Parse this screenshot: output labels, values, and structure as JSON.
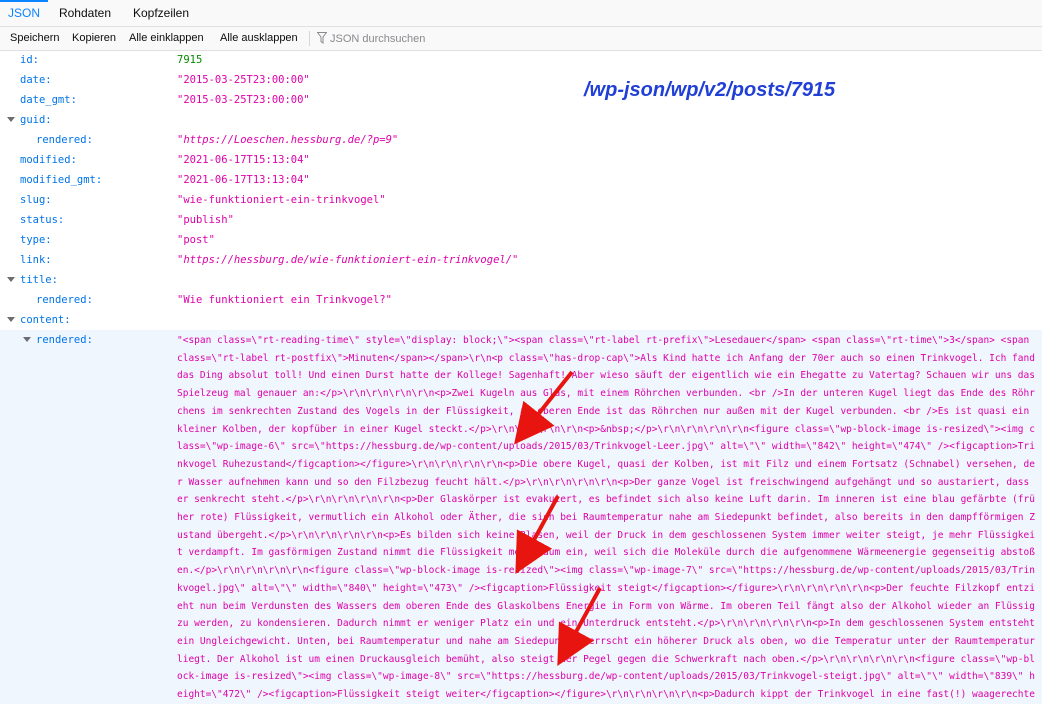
{
  "tabs": [
    {
      "label": "JSON",
      "active": true
    },
    {
      "label": "Rohdaten",
      "active": false
    },
    {
      "label": "Kopfzeilen",
      "active": false
    }
  ],
  "toolbar": {
    "save_label": "Speichern",
    "copy_label": "Kopieren",
    "collapse_all_label": "Alle einklappen",
    "expand_all_label": "Alle ausklappen",
    "filter_placeholder": "JSON durchsuchen"
  },
  "annotation": {
    "endpoint": "/wp-json/wp/v2/posts/7915",
    "color": "#1f3fd6",
    "arrow_color": "#e8140f"
  },
  "json": {
    "id": {
      "key": "id:",
      "value": "7915"
    },
    "date": {
      "key": "date:",
      "value": "\"2015-03-25T23:00:00\""
    },
    "date_gmt": {
      "key": "date_gmt:",
      "value": "\"2015-03-25T23:00:00\""
    },
    "guid": {
      "key": "guid:"
    },
    "guid_rendered": {
      "key": "rendered:",
      "value": "\"https://Loeschen.hessburg.de/?p=9\""
    },
    "modified": {
      "key": "modified:",
      "value": "\"2021-06-17T15:13:04\""
    },
    "modified_gmt": {
      "key": "modified_gmt:",
      "value": "\"2021-06-17T13:13:04\""
    },
    "slug": {
      "key": "slug:",
      "value": "\"wie-funktioniert-ein-trinkvogel\""
    },
    "status": {
      "key": "status:",
      "value": "\"publish\""
    },
    "type": {
      "key": "type:",
      "value": "\"post\""
    },
    "link": {
      "key": "link:",
      "value": "\"https://hessburg.de/wie-funktioniert-ein-trinkvogel/\""
    },
    "title": {
      "key": "title:"
    },
    "title_rendered": {
      "key": "rendered:",
      "value": "\"Wie funktioniert ein Trinkvogel?\""
    },
    "content": {
      "key": "content:"
    },
    "content_rendered": {
      "key": "rendered:",
      "value": "\"<span class=\\\"rt-reading-time\\\" style=\\\"display: block;\\\"><span class=\\\"rt-label rt-prefix\\\">Lesedauer</span> <span class=\\\"rt-time\\\">3</span> <span class=\\\"rt-label rt-postfix\\\">Minuten</span></span>\\r\\n<p class=\\\"has-drop-cap\\\">Als Kind hatte ich Anfang der 70er auch so einen Trinkvogel. Ich fand das Ding absolut toll! Und einen Durst hatte der Kollege! Sagenhaft! Aber wieso säuft der eigentlich wie ein Ehegatte zu Vatertag? Schauen wir uns das Spielzeug mal genauer an:</p>\\r\\n\\r\\n\\r\\n\\r\\n<p>Zwei Kugeln aus Glas, mit einem Röhrchen verbunden. <br />In der unteren Kugel liegt das Ende des Röhrchens im senkrechten Zustand des Vogels in der Flüssigkeit, am oberen Ende ist das Röhrchen nur außen mit der Kugel verbunden. <br />Es ist quasi ein kleiner Kolben, der kopfüber in einer Kugel steckt.</p>\\r\\n\\r\\n\\r\\n\\r\\n<p>&nbsp;</p>\\r\\n\\r\\n\\r\\n\\r\\n<figure class=\\\"wp-block-image is-resized\\\"><img class=\\\"wp-image-6\\\" src=\\\"https://hessburg.de/wp-content/uploads/2015/03/Trinkvogel-Leer.jpg\\\" alt=\\\"\\\" width=\\\"842\\\" height=\\\"474\\\" /><figcaption>Trinkvogel Ruhezustand</figcaption></figure>\\r\\n\\r\\n\\r\\n\\r\\n<p>Die obere Kugel, quasi der Kolben, ist mit Filz und einem Fortsatz (Schnabel) versehen, der Wasser aufnehmen kann und so den Filzbezug feucht hält.</p>\\r\\n\\r\\n\\r\\n\\r\\n<p>Der ganze Vogel ist freischwingend aufgehängt und so austariert, dass er senkrecht steht.</p>\\r\\n\\r\\n\\r\\n\\r\\n<p>Der Glaskörper ist evakuiert, es befindet sich also keine Luft darin. Im inneren ist eine blau gefärbte (früher rote) Flüssigkeit, vermutlich ein Alkohol oder Äther, die sich bei Raumtemperatur nahe am Siedepunkt befindet, also bereits in den dampfförmigen Zustand übergeht.</p>\\r\\n\\r\\n\\r\\n\\r\\n<p>Es bilden sich keine Blasen, weil der Druck in dem geschlossenen System immer weiter steigt, je mehr Flüssigkeit verdampft. Im gasförmigen Zustand nimmt die Flüssigkeit mehr Raum ein, weil sich die Moleküle durch die aufgenommene Wärmeenergie gegenseitig abstoßen.</p>\\r\\n\\r\\n\\r\\n\\r\\n<figure class=\\\"wp-block-image is-resized\\\"><img class=\\\"wp-image-7\\\" src=\\\"https://hessburg.de/wp-content/uploads/2015/03/Trinkvogel.jpg\\\" alt=\\\"\\\" width=\\\"840\\\" height=\\\"473\\\" /><figcaption>Flüssigkeit steigt</figcaption></figure>\\r\\n\\r\\n\\r\\n\\r\\n<p>Der feuchte Filzkopf entzieht nun beim Verdunsten des Wassers dem oberen Ende des Glaskolbens Energie in Form von Wärme. Im oberen Teil fängt also der Alkohol wieder an Flüssig zu werden, zu kondensieren. Dadurch nimmt er weniger Platz ein und ein Unterdruck entsteht.</p>\\r\\n\\r\\n\\r\\n\\r\\n<p>In dem geschlossenen System entsteht ein Ungleichgewicht. Unten, bei Raumtemperatur und nahe am Siedepunkt, herrscht ein höherer Druck als oben, wo die Temperatur unter der Raumtemperatur liegt. Der Alkohol ist um einen Druckausgleich bemüht, also steigt der Pegel gegen die Schwerkraft nach oben.</p>\\r\\n\\r\\n\\r\\n\\r\\n<figure class=\\\"wp-block-image is-resized\\\"><img class=\\\"wp-image-8\\\" src=\\\"https://hessburg.de/wp-content/uploads/2015/03/Trinkvogel-steigt.jpg\\\" alt=\\\"\\\" width=\\\"839\\\" height=\\\"472\\\" /><figcaption>Flüssigkeit steigt weiter</figcaption></figure>\\r\\n\\r\\n\\r\\n\\r\\n<p>Dadurch kippt der Trinkvogel in eine fast(!) waagerechte Position, das untere Ende der Röhre wird aus der Flüssigkeit gehoben, der"
    }
  }
}
